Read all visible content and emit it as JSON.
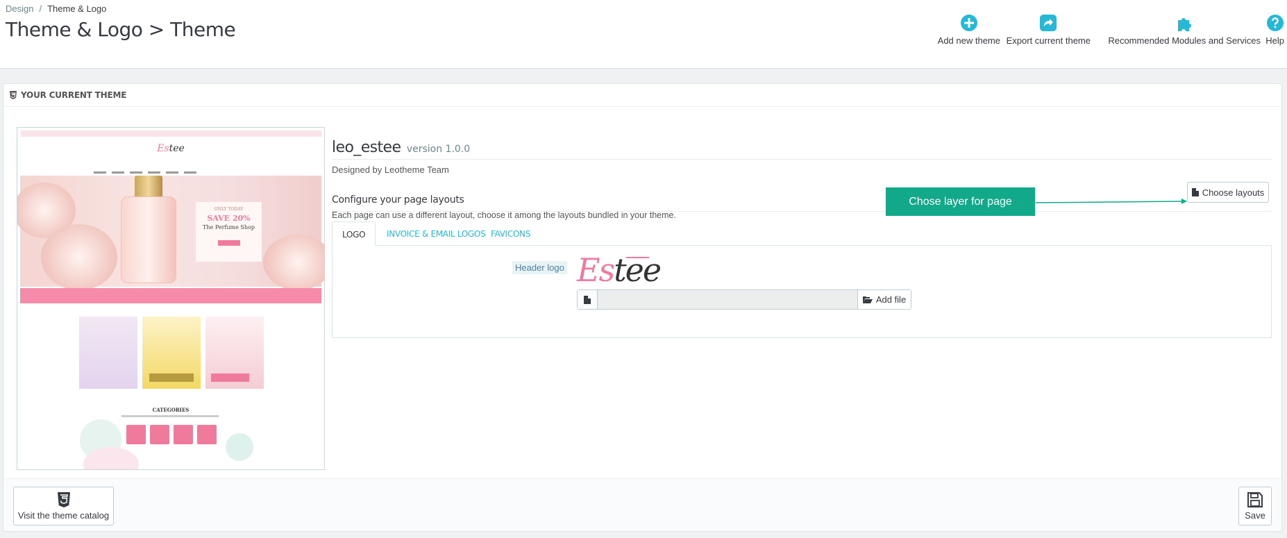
{
  "breadcrumb": {
    "parent": "Design",
    "separator": "/",
    "current": "Theme & Logo"
  },
  "page": {
    "title": "Theme & Logo > Theme"
  },
  "toolbar": {
    "add_new_theme": "Add new theme",
    "export_current_theme": "Export current theme",
    "recommended_modules": "Recommended Modules and Services",
    "help": "Help"
  },
  "panel": {
    "heading": "YOUR CURRENT THEME"
  },
  "theme": {
    "name": "leo_estee",
    "version": "version 1.0.0",
    "designed_by": "Designed by Leotheme Team"
  },
  "preview": {
    "logo_part1": "Es",
    "logo_part2": "tee",
    "hero_l1": "ONLY TODAY",
    "hero_l2": "SAVE 20%",
    "hero_l3": "The Perfume Shop",
    "categories_title": "CATEGORIES"
  },
  "layouts": {
    "title": "Configure your page layouts",
    "description": "Each page can use a different layout, choose it among the layouts bundled in your theme.",
    "button": "Choose layouts"
  },
  "annotation": {
    "text": "Chose layer for page"
  },
  "tabs": [
    {
      "label": "LOGO",
      "active": true
    },
    {
      "label": "INVOICE & EMAIL LOGOS",
      "active": false
    },
    {
      "label": "FAVICONS",
      "active": false
    }
  ],
  "logo_tab": {
    "label": "Header logo",
    "logo_part1": "Es",
    "logo_part2": "tee",
    "file_value": "",
    "add_file": "Add file"
  },
  "footer": {
    "catalog": "Visit the theme catalog",
    "save": "Save"
  },
  "colors": {
    "accent": "#25b9d7",
    "annotation": "#12a98b",
    "brand_pink": "#f07a9b"
  }
}
